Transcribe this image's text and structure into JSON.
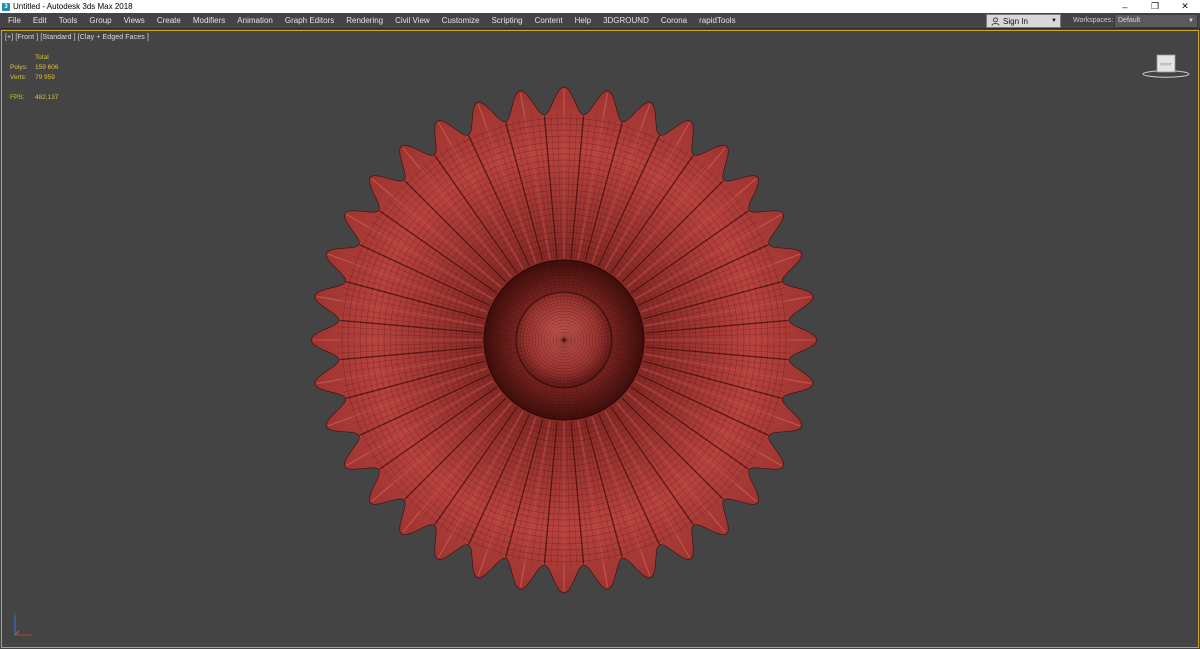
{
  "window": {
    "title": "Untitled - Autodesk 3ds Max 2018",
    "controls": {
      "minimize": "–",
      "restore": "❐",
      "close": "✕"
    }
  },
  "menu": [
    "File",
    "Edit",
    "Tools",
    "Group",
    "Views",
    "Create",
    "Modifiers",
    "Animation",
    "Graph Editors",
    "Rendering",
    "Civil View",
    "Customize",
    "Scripting",
    "Content",
    "Help",
    "3DGROUND",
    "Corona",
    "rapidTools"
  ],
  "signin": {
    "label": "Sign In"
  },
  "workspaces": {
    "label": "Workspaces:",
    "value": "Default"
  },
  "viewport": {
    "label": "[+] [Front ] [Standard ] [Clay + Edged Faces ]",
    "stats": {
      "header": "Total",
      "polys_label": "Polys:",
      "polys_value": "159 606",
      "verts_label": "Verts:",
      "verts_value": "79 959",
      "fps_label": "FPS:",
      "fps_value": "482,137"
    },
    "viewcube_label": "FRONT"
  },
  "colors": {
    "model": "#b8423e",
    "viewport_border": "#c9a62a",
    "stats_text": "#d8c23a"
  }
}
